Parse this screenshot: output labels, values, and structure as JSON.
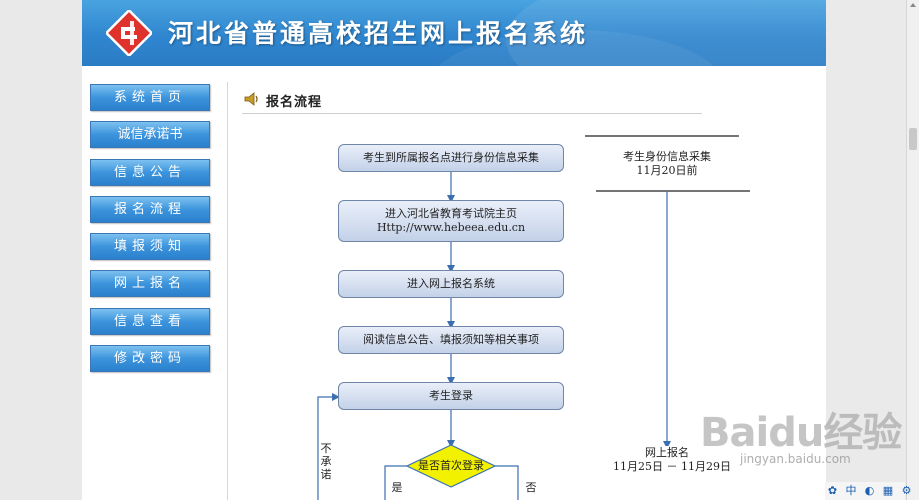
{
  "header": {
    "title": "河北省普通高校招生网上报名系统"
  },
  "nav": {
    "items": [
      {
        "label": "系统首页",
        "name": "nav-home"
      },
      {
        "label": "诚信承诺书",
        "name": "nav-integrity-pledge"
      },
      {
        "label": "信息公告",
        "name": "nav-announcements"
      },
      {
        "label": "报名流程",
        "name": "nav-registration-process"
      },
      {
        "label": "填报须知",
        "name": "nav-filling-notice"
      },
      {
        "label": "网上报名",
        "name": "nav-online-registration"
      },
      {
        "label": "信息查看",
        "name": "nav-info-view"
      },
      {
        "label": "修改密码",
        "name": "nav-change-password"
      }
    ]
  },
  "section": {
    "title": "报名流程"
  },
  "flow": {
    "step1": "考生到所属报名点进行身份信息采集",
    "step2_line1": "进入河北省教育考试院主页",
    "step2_line2": "Http://www.hebeea.edu.cn",
    "step3": "进入网上报名系统",
    "step4": "阅读信息公告、填报须知等相关事项",
    "step5": "考生登录",
    "decision": "是否首次登录",
    "yes": "是",
    "no": "否",
    "not_commit": "不承诺"
  },
  "timeline": {
    "collect_label": "考生身份信息采集",
    "collect_date": "11月20日前",
    "online_label": "网上报名",
    "online_date": "11月25日 － 11月29日"
  },
  "watermark": {
    "brand": "Baidu经验",
    "url": "jingyan.baidu.com"
  },
  "tray": {
    "items": [
      "中",
      "⚙"
    ]
  },
  "colors": {
    "header_blue": "#2f86cf",
    "nav_blue": "#3d94dc",
    "box_border": "#6f86a8",
    "arrow_blue": "#3b6fb0",
    "decision_yellow": "#f2f200"
  }
}
